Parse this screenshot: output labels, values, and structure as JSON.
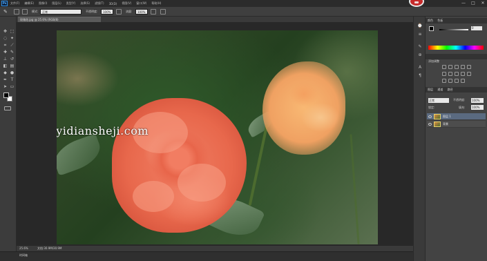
{
  "app": {
    "logo": "Ps"
  },
  "menu": [
    "文件(F)",
    "编辑(E)",
    "图像(I)",
    "图层(L)",
    "类型(Y)",
    "选择(S)",
    "滤镜(T)",
    "3D(D)",
    "视图(V)",
    "窗口(W)",
    "帮助(H)"
  ],
  "window_controls": [
    "—",
    "□",
    "✕"
  ],
  "options": {
    "mode_label": "模式:",
    "mode_value": "正常",
    "opacity_label": "不透明度:",
    "opacity_value": "100%",
    "flow_label": "流量:",
    "flow_value": "100%"
  },
  "document": {
    "tab_title": "玫瑰花.jpg @ 25.6% (RGB/8)",
    "zoom": "25.6%",
    "doc_size": "文档:30.9M/30.9M"
  },
  "watermark": "www.haoyidiansheji.com",
  "timeline": {
    "tab": "时间轴"
  },
  "panels": {
    "color_tabs": [
      "颜色",
      "色板"
    ],
    "slider_value": "0",
    "adjust_title": "添加调整",
    "layers_tabs": [
      "图层",
      "通道",
      "路径"
    ],
    "blend_mode": "正常",
    "opacity_label": "不透明度:",
    "opacity_value": "100%",
    "lock_label": "锁定:",
    "fill_label": "填充:",
    "fill_value": "100%",
    "layers": [
      {
        "name": "图层 1",
        "selected": true
      },
      {
        "name": "背景",
        "selected": false
      }
    ]
  }
}
